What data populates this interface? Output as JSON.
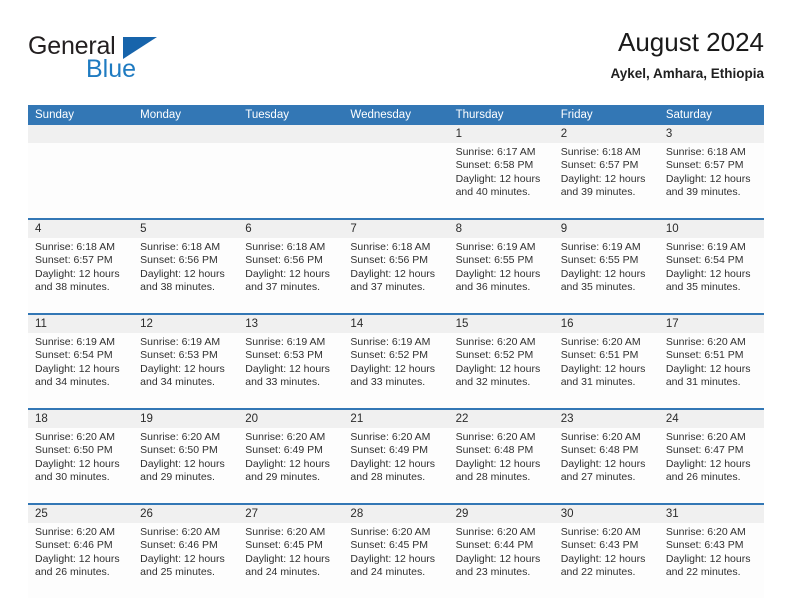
{
  "brand": {
    "name_part1": "General",
    "name_part2": "Blue",
    "accent_color": "#1764ab",
    "text_color": "#231f20"
  },
  "header": {
    "title": "August 2024",
    "location": "Aykel, Amhara, Ethiopia"
  },
  "theme": {
    "header_bar_color": "#3377b5",
    "daynum_band_color": "#f0f0f0",
    "cell_bg_color": "#fdfdfd"
  },
  "weekdays": [
    "Sunday",
    "Monday",
    "Tuesday",
    "Wednesday",
    "Thursday",
    "Friday",
    "Saturday"
  ],
  "weeks": [
    [
      {
        "day": "",
        "lines": []
      },
      {
        "day": "",
        "lines": []
      },
      {
        "day": "",
        "lines": []
      },
      {
        "day": "",
        "lines": []
      },
      {
        "day": "1",
        "lines": [
          "Sunrise: 6:17 AM",
          "Sunset: 6:58 PM",
          "Daylight: 12 hours",
          "and 40 minutes."
        ]
      },
      {
        "day": "2",
        "lines": [
          "Sunrise: 6:18 AM",
          "Sunset: 6:57 PM",
          "Daylight: 12 hours",
          "and 39 minutes."
        ]
      },
      {
        "day": "3",
        "lines": [
          "Sunrise: 6:18 AM",
          "Sunset: 6:57 PM",
          "Daylight: 12 hours",
          "and 39 minutes."
        ]
      }
    ],
    [
      {
        "day": "4",
        "lines": [
          "Sunrise: 6:18 AM",
          "Sunset: 6:57 PM",
          "Daylight: 12 hours",
          "and 38 minutes."
        ]
      },
      {
        "day": "5",
        "lines": [
          "Sunrise: 6:18 AM",
          "Sunset: 6:56 PM",
          "Daylight: 12 hours",
          "and 38 minutes."
        ]
      },
      {
        "day": "6",
        "lines": [
          "Sunrise: 6:18 AM",
          "Sunset: 6:56 PM",
          "Daylight: 12 hours",
          "and 37 minutes."
        ]
      },
      {
        "day": "7",
        "lines": [
          "Sunrise: 6:18 AM",
          "Sunset: 6:56 PM",
          "Daylight: 12 hours",
          "and 37 minutes."
        ]
      },
      {
        "day": "8",
        "lines": [
          "Sunrise: 6:19 AM",
          "Sunset: 6:55 PM",
          "Daylight: 12 hours",
          "and 36 minutes."
        ]
      },
      {
        "day": "9",
        "lines": [
          "Sunrise: 6:19 AM",
          "Sunset: 6:55 PM",
          "Daylight: 12 hours",
          "and 35 minutes."
        ]
      },
      {
        "day": "10",
        "lines": [
          "Sunrise: 6:19 AM",
          "Sunset: 6:54 PM",
          "Daylight: 12 hours",
          "and 35 minutes."
        ]
      }
    ],
    [
      {
        "day": "11",
        "lines": [
          "Sunrise: 6:19 AM",
          "Sunset: 6:54 PM",
          "Daylight: 12 hours",
          "and 34 minutes."
        ]
      },
      {
        "day": "12",
        "lines": [
          "Sunrise: 6:19 AM",
          "Sunset: 6:53 PM",
          "Daylight: 12 hours",
          "and 34 minutes."
        ]
      },
      {
        "day": "13",
        "lines": [
          "Sunrise: 6:19 AM",
          "Sunset: 6:53 PM",
          "Daylight: 12 hours",
          "and 33 minutes."
        ]
      },
      {
        "day": "14",
        "lines": [
          "Sunrise: 6:19 AM",
          "Sunset: 6:52 PM",
          "Daylight: 12 hours",
          "and 33 minutes."
        ]
      },
      {
        "day": "15",
        "lines": [
          "Sunrise: 6:20 AM",
          "Sunset: 6:52 PM",
          "Daylight: 12 hours",
          "and 32 minutes."
        ]
      },
      {
        "day": "16",
        "lines": [
          "Sunrise: 6:20 AM",
          "Sunset: 6:51 PM",
          "Daylight: 12 hours",
          "and 31 minutes."
        ]
      },
      {
        "day": "17",
        "lines": [
          "Sunrise: 6:20 AM",
          "Sunset: 6:51 PM",
          "Daylight: 12 hours",
          "and 31 minutes."
        ]
      }
    ],
    [
      {
        "day": "18",
        "lines": [
          "Sunrise: 6:20 AM",
          "Sunset: 6:50 PM",
          "Daylight: 12 hours",
          "and 30 minutes."
        ]
      },
      {
        "day": "19",
        "lines": [
          "Sunrise: 6:20 AM",
          "Sunset: 6:50 PM",
          "Daylight: 12 hours",
          "and 29 minutes."
        ]
      },
      {
        "day": "20",
        "lines": [
          "Sunrise: 6:20 AM",
          "Sunset: 6:49 PM",
          "Daylight: 12 hours",
          "and 29 minutes."
        ]
      },
      {
        "day": "21",
        "lines": [
          "Sunrise: 6:20 AM",
          "Sunset: 6:49 PM",
          "Daylight: 12 hours",
          "and 28 minutes."
        ]
      },
      {
        "day": "22",
        "lines": [
          "Sunrise: 6:20 AM",
          "Sunset: 6:48 PM",
          "Daylight: 12 hours",
          "and 28 minutes."
        ]
      },
      {
        "day": "23",
        "lines": [
          "Sunrise: 6:20 AM",
          "Sunset: 6:48 PM",
          "Daylight: 12 hours",
          "and 27 minutes."
        ]
      },
      {
        "day": "24",
        "lines": [
          "Sunrise: 6:20 AM",
          "Sunset: 6:47 PM",
          "Daylight: 12 hours",
          "and 26 minutes."
        ]
      }
    ],
    [
      {
        "day": "25",
        "lines": [
          "Sunrise: 6:20 AM",
          "Sunset: 6:46 PM",
          "Daylight: 12 hours",
          "and 26 minutes."
        ]
      },
      {
        "day": "26",
        "lines": [
          "Sunrise: 6:20 AM",
          "Sunset: 6:46 PM",
          "Daylight: 12 hours",
          "and 25 minutes."
        ]
      },
      {
        "day": "27",
        "lines": [
          "Sunrise: 6:20 AM",
          "Sunset: 6:45 PM",
          "Daylight: 12 hours",
          "and 24 minutes."
        ]
      },
      {
        "day": "28",
        "lines": [
          "Sunrise: 6:20 AM",
          "Sunset: 6:45 PM",
          "Daylight: 12 hours",
          "and 24 minutes."
        ]
      },
      {
        "day": "29",
        "lines": [
          "Sunrise: 6:20 AM",
          "Sunset: 6:44 PM",
          "Daylight: 12 hours",
          "and 23 minutes."
        ]
      },
      {
        "day": "30",
        "lines": [
          "Sunrise: 6:20 AM",
          "Sunset: 6:43 PM",
          "Daylight: 12 hours",
          "and 22 minutes."
        ]
      },
      {
        "day": "31",
        "lines": [
          "Sunrise: 6:20 AM",
          "Sunset: 6:43 PM",
          "Daylight: 12 hours",
          "and 22 minutes."
        ]
      }
    ]
  ]
}
